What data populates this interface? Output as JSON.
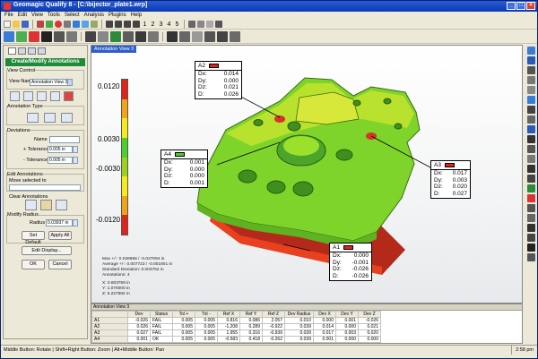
{
  "window": {
    "title": "Geomagic Qualify 8 - [C:\\bijector_plate1.wrp]",
    "controls": [
      "_",
      "□",
      "×"
    ]
  },
  "menu": [
    "File",
    "Edit",
    "View",
    "Tools",
    "Select",
    "Analysis",
    "Plugins",
    "Help"
  ],
  "toolbar_numbers": [
    "1",
    "2",
    "3",
    "4",
    "5"
  ],
  "panel": {
    "header": "Create/Modify Annotations",
    "view_control": {
      "label": "View Control",
      "view_name_label": "View Name",
      "view_name_value": "Annotation View 3"
    },
    "annotation_type_label": "Annotation Type",
    "deviations": {
      "label": "Deviations",
      "name_label": "Name",
      "plus_tol_label": "+ Tolerance",
      "plus_tol_value": "0.005 in",
      "minus_tol_label": "- Tolerance",
      "minus_tol_value": "0.005 in"
    },
    "edit_annotations": {
      "label": "Edit Annotations",
      "move_selected_label": "Move selected to"
    },
    "clear_annotations_label": "Clear Annotations",
    "modify_radius": {
      "label": "Modify Radius",
      "radius_label": "Radius",
      "radius_value": "0.03937 in"
    },
    "set_default": "Set Default",
    "apply_all": "Apply All",
    "edit_display": "Edit Display...",
    "ok": "OK",
    "cancel": "Cancel"
  },
  "viewport": {
    "tab": "Annotation View 3",
    "colorbar": {
      "labels": [
        "0.0120",
        "0.0030",
        "-0.0030",
        "-0.0120"
      ],
      "colors": [
        "#e2231a",
        "#f3a316",
        "#f6ea1c",
        "#4ecf2a",
        "#9ad31a",
        "#f6ea1c",
        "#f3a316",
        "#e2231a"
      ]
    },
    "stats": [
      "Max +/-: 0.026858 / -0.027094 in",
      "Average +/-: 0.007723 / -0.001901 in",
      "Standard Deviation: 0.003752 in",
      "Annotations: 4",
      "",
      "X: 0.803769 in",
      "Y: 1.070000 in",
      "Z: 5.227882 in"
    ],
    "annotations": [
      {
        "id": "A2",
        "color": "#e2231a",
        "rows": [
          [
            "Dx:",
            "0.014"
          ],
          [
            "Dy:",
            "0.000"
          ],
          [
            "Dz:",
            "0.021"
          ],
          [
            "D:",
            "0.026"
          ]
        ]
      },
      {
        "id": "A4",
        "color": "#4ecf2a",
        "rows": [
          [
            "Dx:",
            "0.001"
          ],
          [
            "Dy:",
            "0.000"
          ],
          [
            "Dz:",
            "0.000"
          ],
          [
            "D:",
            "0.001"
          ]
        ]
      },
      {
        "id": "A3",
        "color": "#e2231a",
        "rows": [
          [
            "Dx:",
            "0.017"
          ],
          [
            "Dy:",
            "0.003"
          ],
          [
            "Dz:",
            "0.020"
          ],
          [
            "D:",
            "0.027"
          ]
        ]
      },
      {
        "id": "A1",
        "color": "#e2231a",
        "rows": [
          [
            "Dx:",
            "0.000"
          ],
          [
            "Dy:",
            "-0.001"
          ],
          [
            "Dz:",
            "-0.026"
          ],
          [
            "D:",
            "-0.026"
          ]
        ]
      }
    ]
  },
  "table": {
    "title": "Annotation View 3",
    "headers": [
      "",
      "Dev",
      "Status",
      "Tol +",
      "Tol -",
      "Ref X",
      "Ref Y",
      "Ref Z",
      "Dev Radius",
      "Dev X",
      "Dev Y",
      "Dev Z"
    ],
    "rows": [
      [
        "A1",
        "-0.026",
        "FAIL",
        "0.005",
        "0.005",
        "0.816",
        "0.086",
        "2.057",
        "0.010",
        "0.000",
        "0.001",
        "-0.026"
      ],
      [
        "A2",
        "0.026",
        "FAIL",
        "0.005",
        "0.005",
        "-1.208",
        "0.289",
        "-0.922",
        "0.039",
        "0.014",
        "0.000",
        "0.021"
      ],
      [
        "A3",
        "0.027",
        "FAIL",
        "0.005",
        "0.005",
        "1.955",
        "0.316",
        "-0.939",
        "0.039",
        "0.017",
        "0.003",
        "0.020"
      ],
      [
        "A4",
        "0.001",
        "OK",
        "0.005",
        "0.005",
        "-0.583",
        "0.418",
        "-0.262",
        "0.039",
        "0.001",
        "0.000",
        "0.000"
      ]
    ]
  },
  "status": {
    "text": "Middle Button: Rotate | Shift+Right Button: Zoom | Alt+Middle Button: Pan",
    "clock": "2:58 pm"
  }
}
